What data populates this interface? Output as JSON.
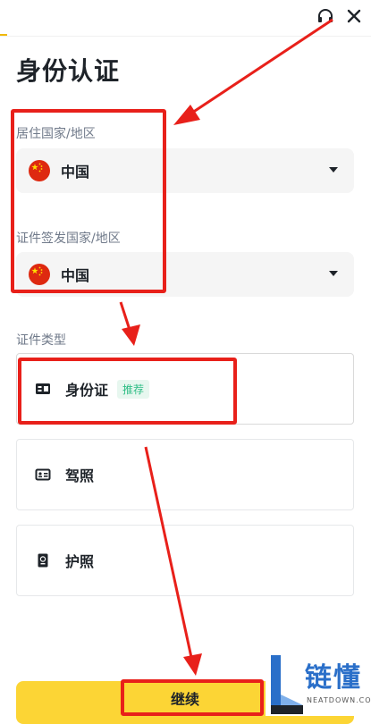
{
  "header": {
    "support_icon": "headset-icon",
    "close_icon": "close-icon",
    "close_symbol": "✕"
  },
  "page": {
    "title": "身份认证"
  },
  "residence": {
    "label": "居住国家/地区",
    "value": "中国",
    "flag_icon": "china-flag-icon"
  },
  "issuing": {
    "label": "证件签发国家/地区",
    "value": "中国",
    "flag_icon": "china-flag-icon"
  },
  "document_type": {
    "label": "证件类型",
    "options": [
      {
        "label": "身份证",
        "badge": "推荐",
        "icon": "id-card-icon"
      },
      {
        "label": "驾照",
        "icon": "driver-license-icon"
      },
      {
        "label": "护照",
        "icon": "passport-icon"
      }
    ]
  },
  "footer": {
    "continue_label": "继续"
  },
  "watermark": {
    "name": "链懂",
    "domain": "NEATDOWN.COM"
  },
  "colors": {
    "accent": "#fcd535",
    "annotation": "#e8201a",
    "badge_green": "#2ebd85",
    "watermark_blue": "#2a6fc9"
  }
}
